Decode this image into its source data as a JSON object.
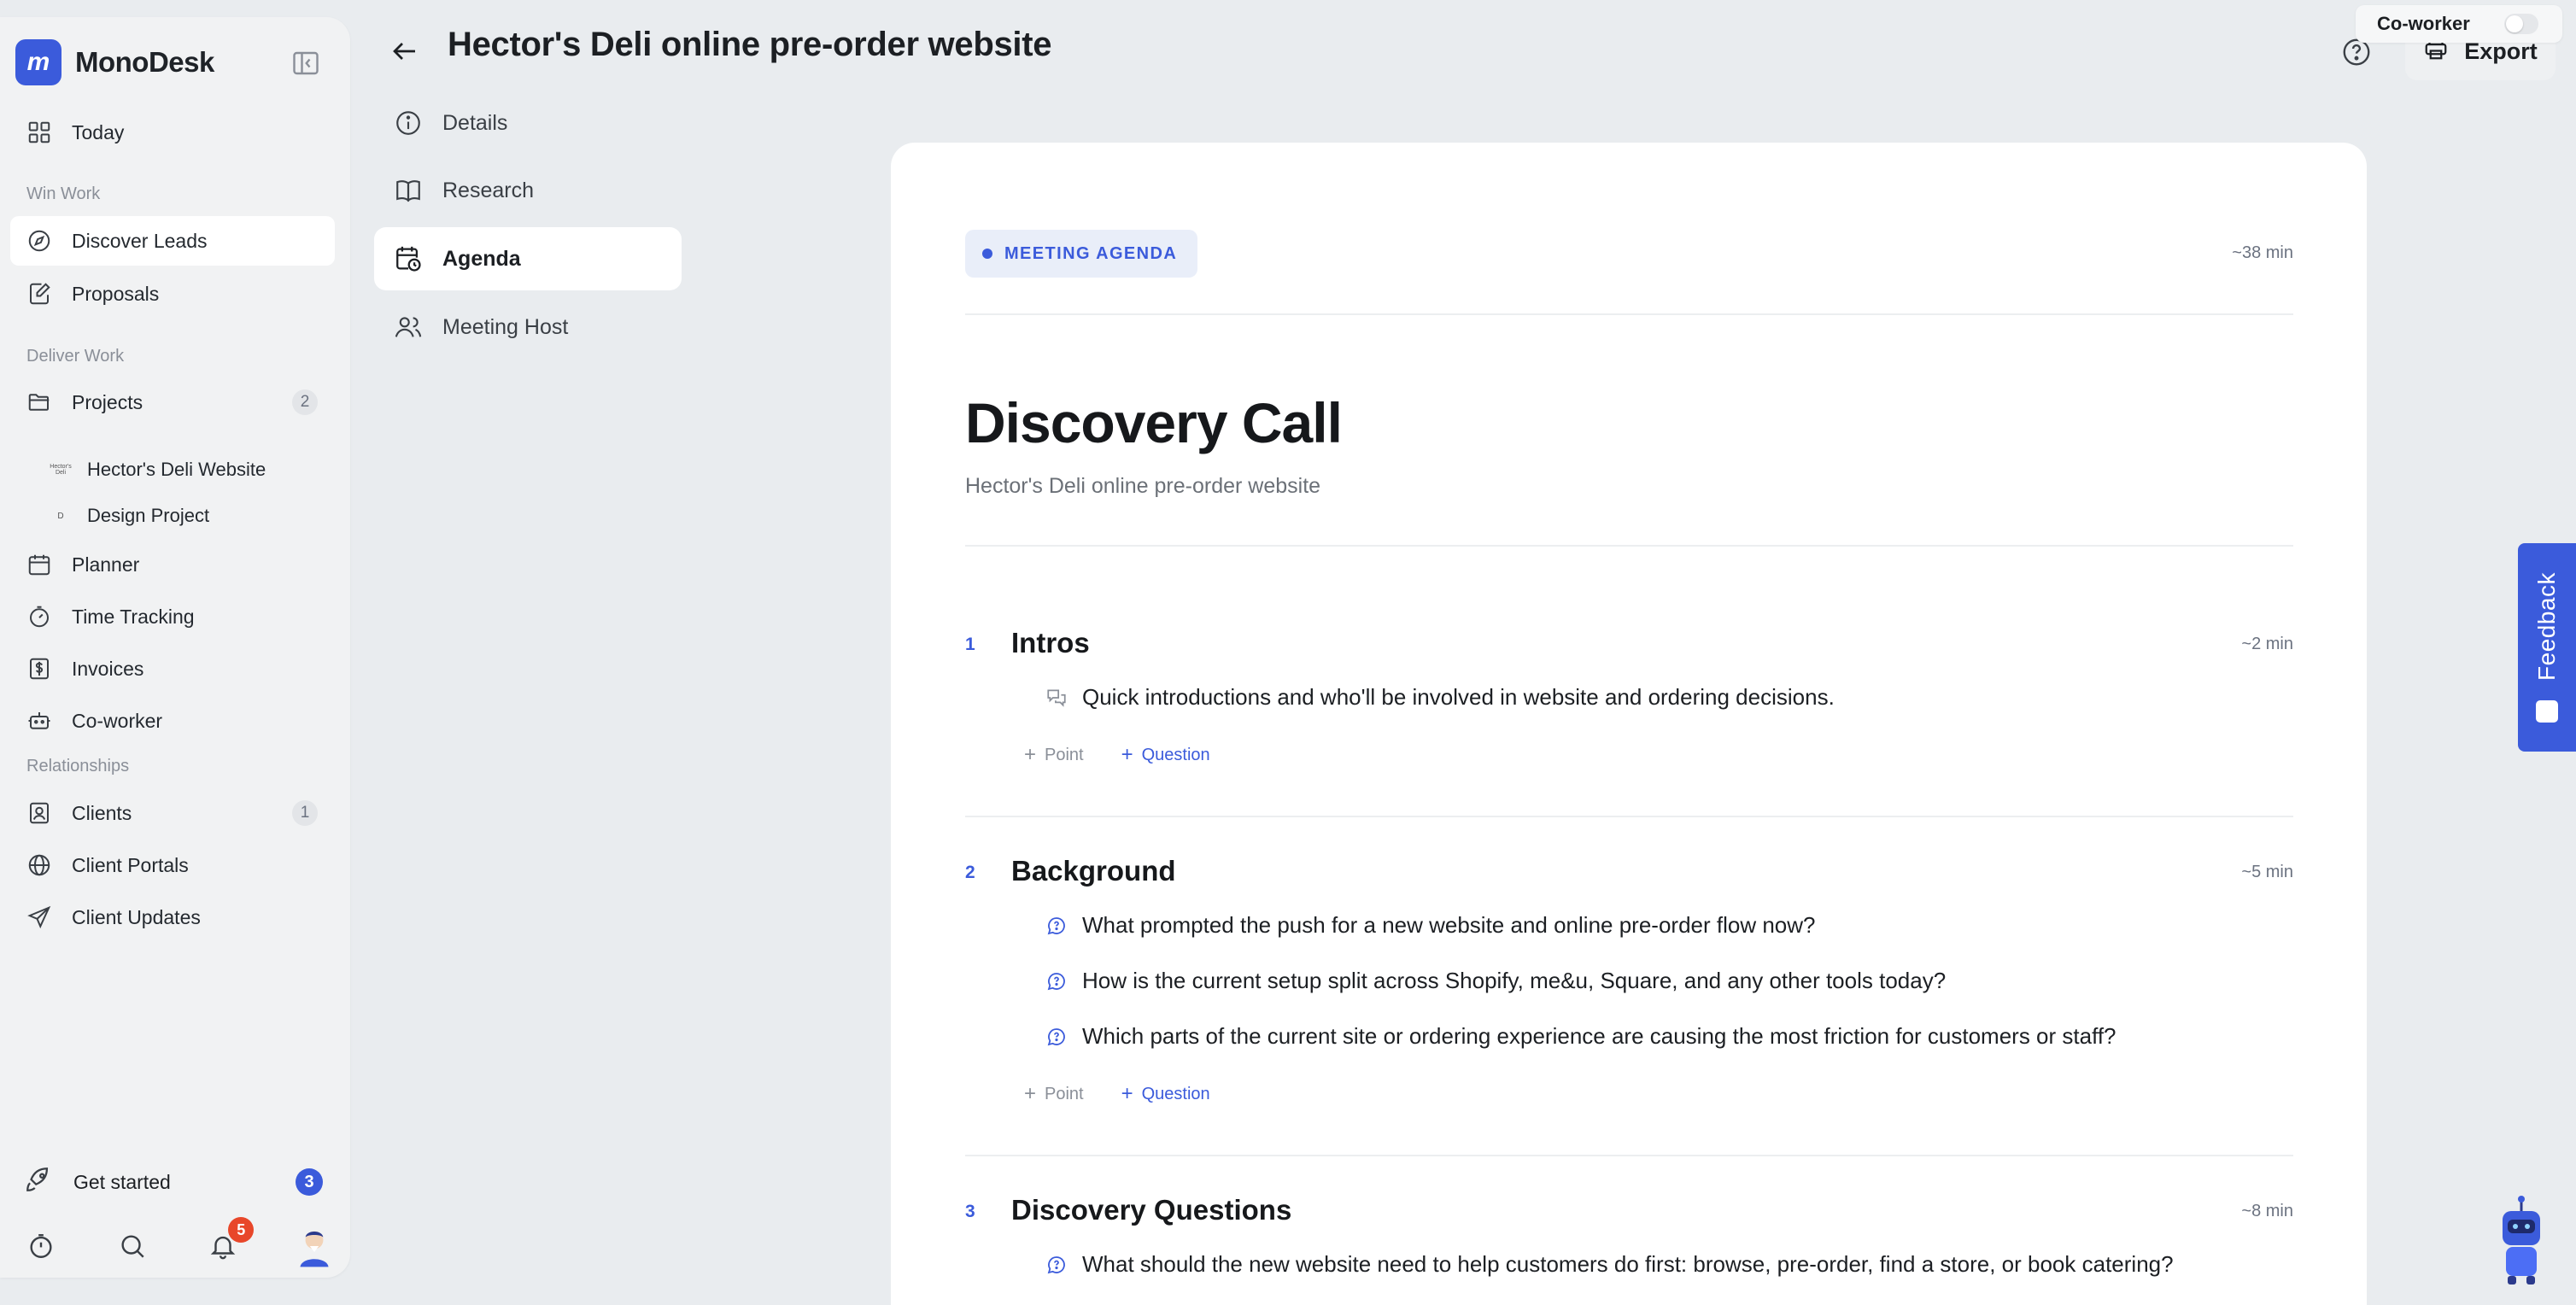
{
  "brand": {
    "name": "MonoDesk",
    "logo_letter": "m"
  },
  "sidebar": {
    "today": "Today",
    "win_work_label": "Win Work",
    "discover_leads": "Discover Leads",
    "proposals": "Proposals",
    "deliver_work_label": "Deliver Work",
    "projects": {
      "label": "Projects",
      "count": "2"
    },
    "project_items": [
      {
        "label": "Hector's Deli Website",
        "mini": "Hector's Deli"
      },
      {
        "label": "Design Project",
        "mini": "D"
      }
    ],
    "planner": "Planner",
    "time_tracking": "Time Tracking",
    "invoices": "Invoices",
    "coworker": "Co-worker",
    "relationships_label": "Relationships",
    "clients": {
      "label": "Clients",
      "count": "1"
    },
    "client_portals": "Client Portals",
    "client_updates": "Client Updates",
    "get_started": {
      "label": "Get started",
      "count": "3"
    },
    "notifications_count": "5"
  },
  "header": {
    "title": "Hector's Deli online pre-order website",
    "export_label": "Export",
    "coworker_toggle_label": "Co-worker"
  },
  "subnav": {
    "details": "Details",
    "research": "Research",
    "agenda": "Agenda",
    "meeting_host": "Meeting Host"
  },
  "doc": {
    "tag": "MEETING AGENDA",
    "total_time": "~38 min",
    "title": "Discovery Call",
    "subtitle": "Hector's Deli online pre-order website",
    "add_point": "Point",
    "add_question": "Question",
    "sections": [
      {
        "num": "1",
        "title": "Intros",
        "time": "~2 min",
        "items": [
          {
            "type": "point",
            "text": "Quick introductions and who'll be involved in website and ordering decisions."
          }
        ]
      },
      {
        "num": "2",
        "title": "Background",
        "time": "~5 min",
        "items": [
          {
            "type": "question",
            "text": "What prompted the push for a new website and online pre-order flow now?"
          },
          {
            "type": "question",
            "text": "How is the current setup split across Shopify, me&u, Square, and any other tools today?"
          },
          {
            "type": "question",
            "text": "Which parts of the current site or ordering experience are causing the most friction for customers or staff?"
          }
        ]
      },
      {
        "num": "3",
        "title": "Discovery Questions",
        "time": "~8 min",
        "items": [
          {
            "type": "question",
            "text": "What should the new website need to help customers do first: browse, pre-order, find a store, or book catering?"
          }
        ]
      }
    ]
  },
  "feedback": {
    "label": "Feedback"
  },
  "colors": {
    "accent": "#3b5bdb",
    "notification": "#e8472a",
    "background": "#e9ecef"
  }
}
